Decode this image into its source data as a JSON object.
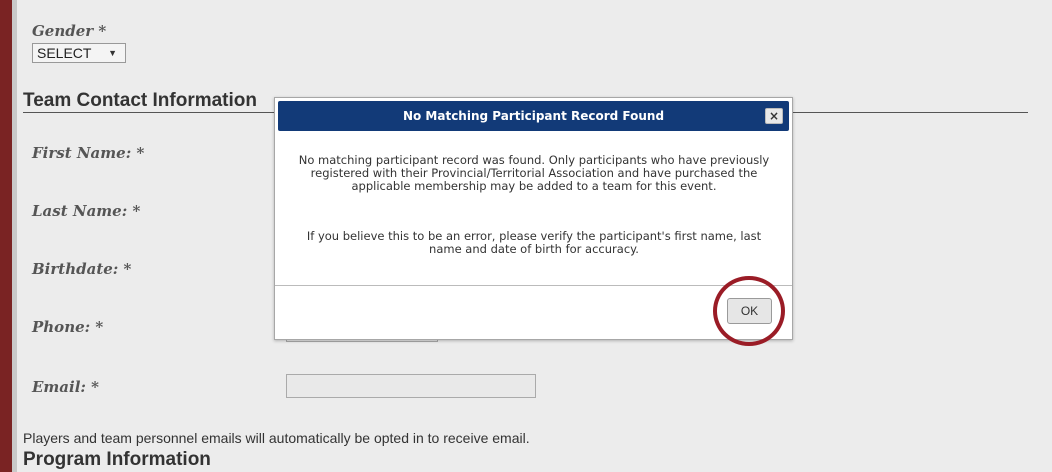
{
  "form": {
    "gender_label": "Gender *",
    "gender_select_value": "SELECT",
    "team_contact_heading": "Team Contact Information",
    "first_name_label": "First Name: *",
    "last_name_label": "Last Name: *",
    "birthdate_label": "Birthdate: *",
    "phone_label": "Phone: *",
    "email_label": "Email: *",
    "email_note": "Players and team personnel emails will automatically be opted in to receive email.",
    "program_heading": "Program Information"
  },
  "dialog": {
    "title": "No Matching Participant Record Found",
    "close_glyph": "×",
    "message_1": "No matching participant record was found. Only participants who have previously registered with their Provincial/Territorial Association and have purchased the applicable membership may be added to a team for this event.",
    "message_2": "If you believe this to be an error, please verify the participant's first name, last name and date of birth for accuracy.",
    "ok_label": "OK"
  },
  "colors": {
    "titlebar": "#123a78",
    "highlight": "#9a1c26",
    "rail": "#7a2323"
  },
  "icons": {
    "close": "close-icon",
    "select_arrow": "chevron-down-icon"
  }
}
